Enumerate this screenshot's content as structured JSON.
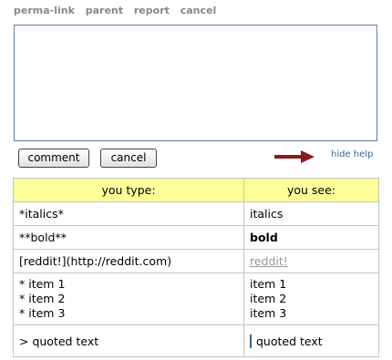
{
  "links": [
    "perma-link",
    "parent",
    "report",
    "cancel"
  ],
  "textarea": {
    "value": ""
  },
  "buttons": {
    "comment": "comment",
    "cancel": "cancel"
  },
  "hide_help": "hide help",
  "help_table": {
    "headers": [
      "you type:",
      "you see:"
    ],
    "rows": {
      "italics": {
        "type": "*italics*",
        "see": "italics"
      },
      "bold": {
        "type": "**bold**",
        "see": "bold"
      },
      "link": {
        "type": "[reddit!](http://reddit.com)",
        "see": "reddit!"
      },
      "list": {
        "type": [
          "* item 1",
          "* item 2",
          "* item 3"
        ],
        "see": [
          "item 1",
          "item 2",
          "item 3"
        ]
      },
      "quote": {
        "type": "> quoted text",
        "see": "quoted text"
      }
    }
  },
  "colors": {
    "header_bg": "#ffff99",
    "arrow": "#8b1a1a",
    "link": "#336699"
  }
}
